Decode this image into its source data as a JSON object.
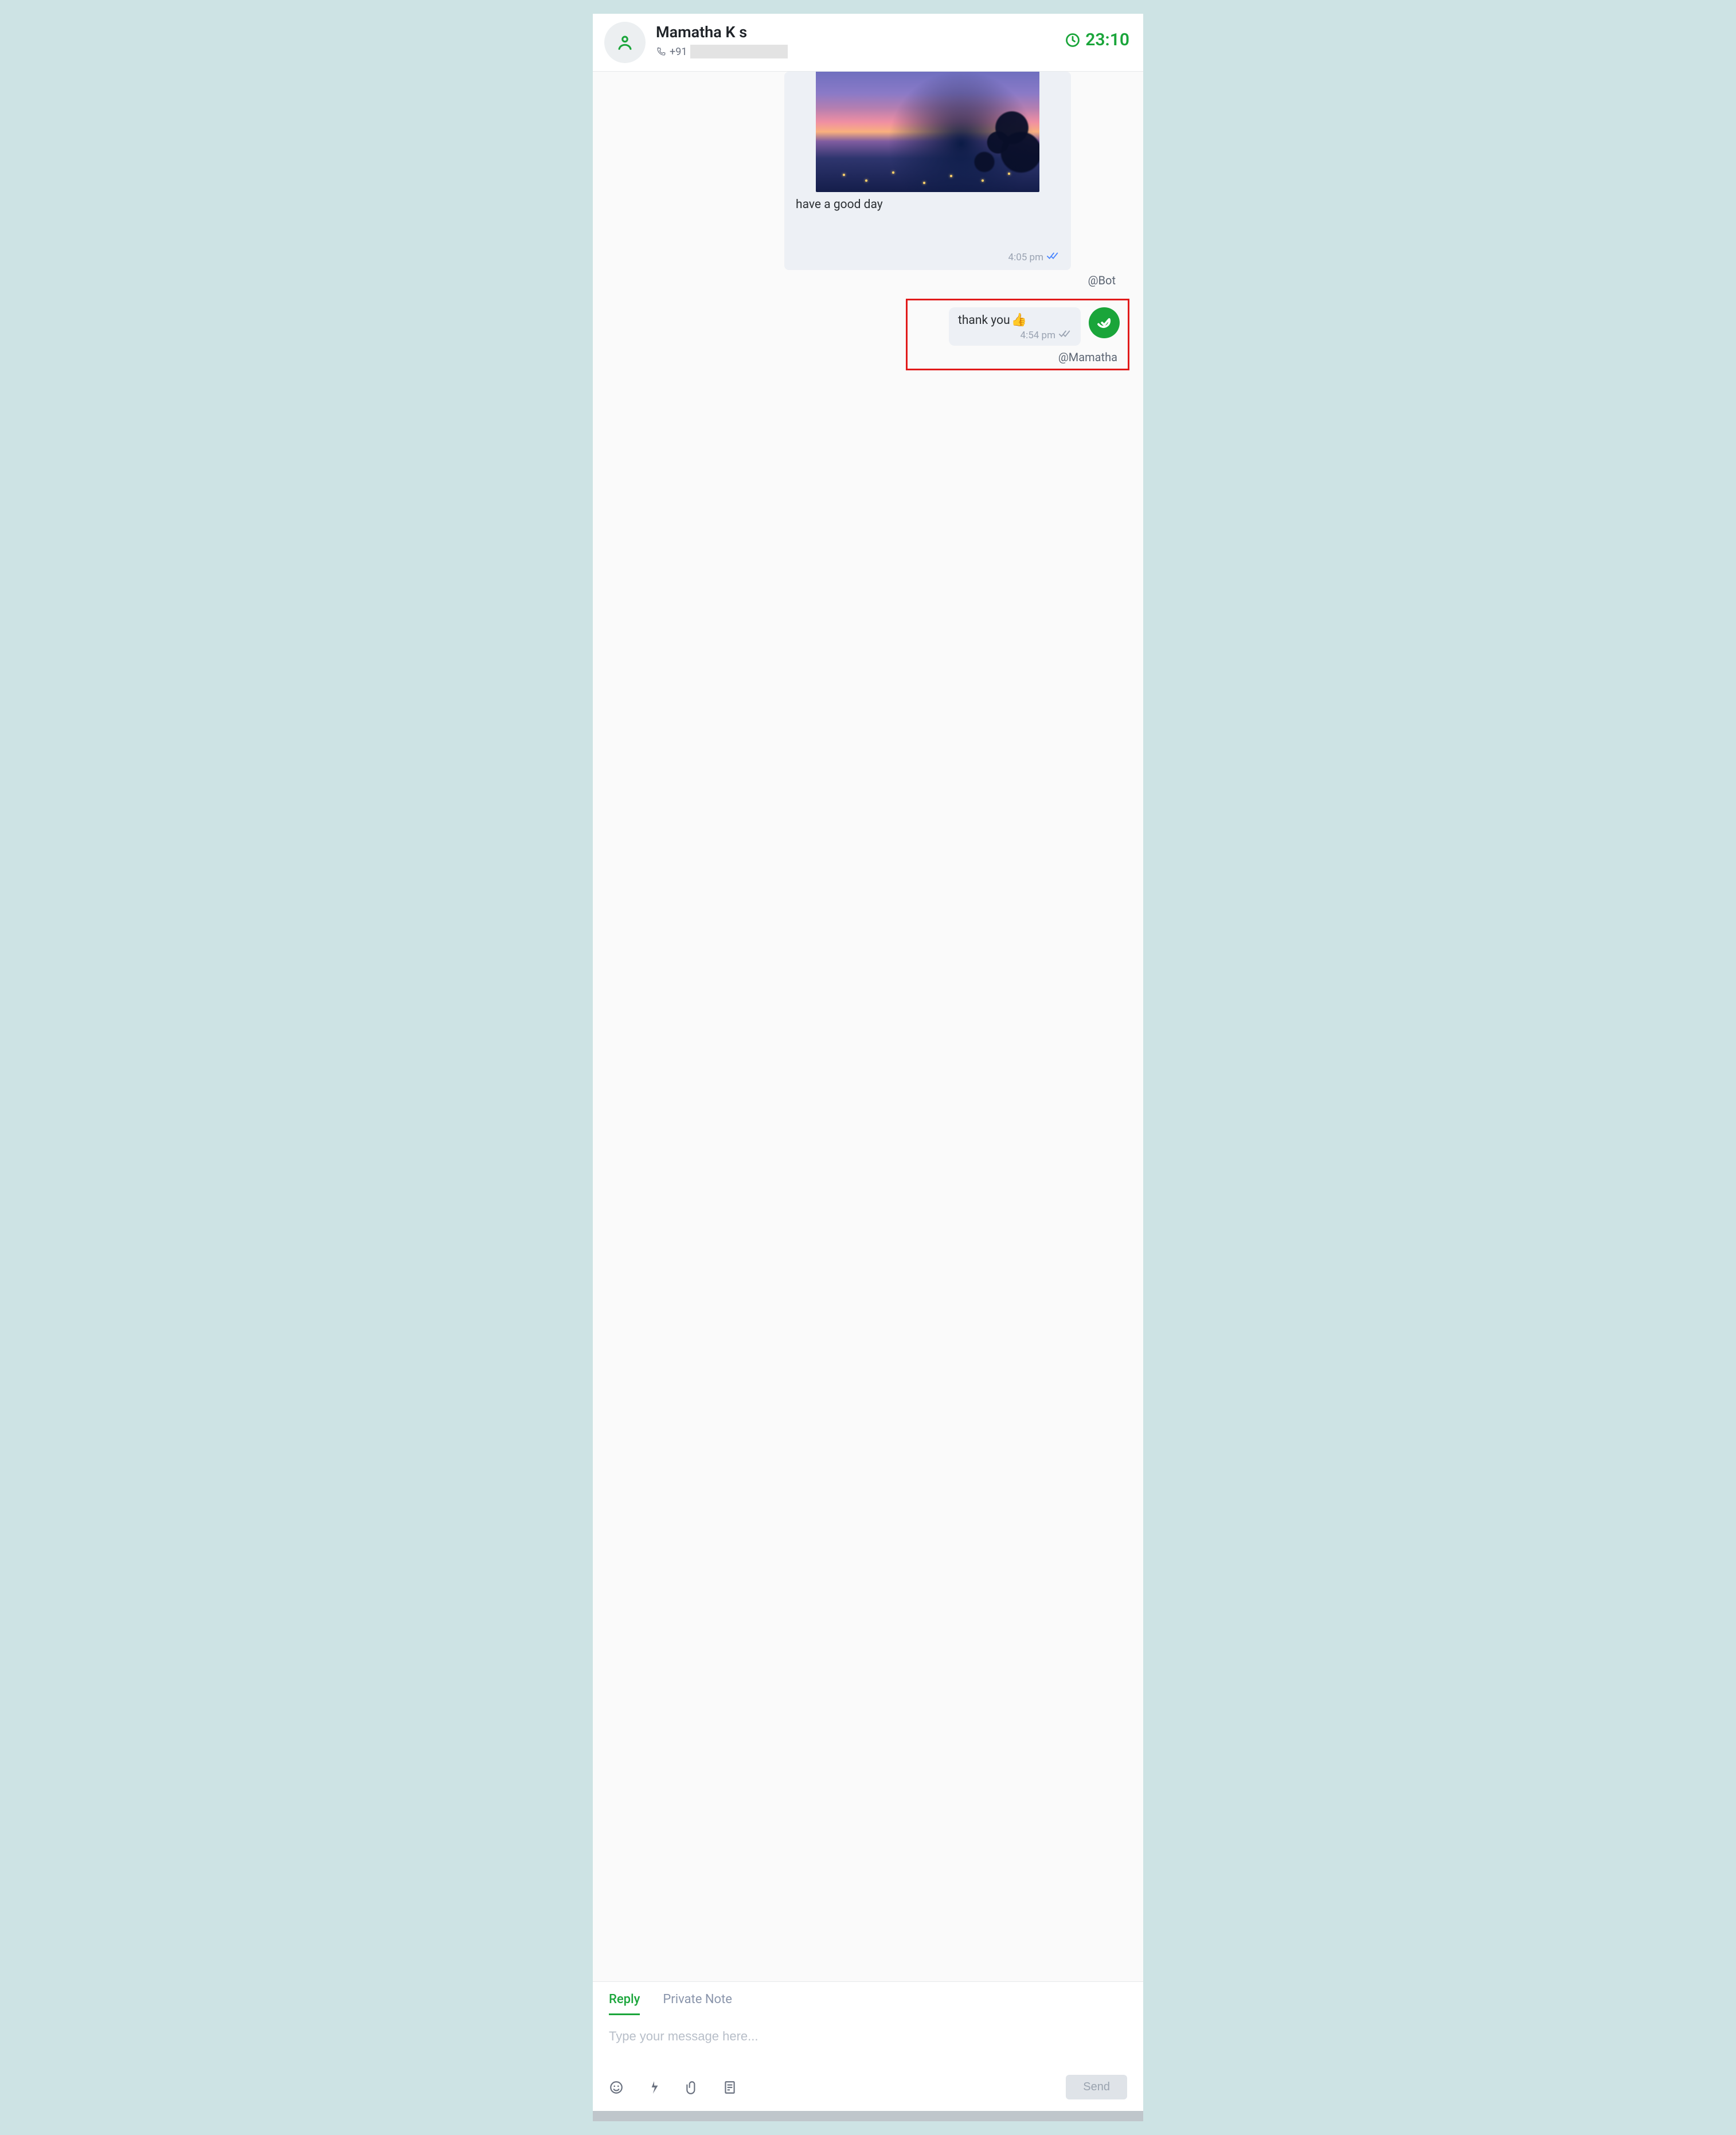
{
  "header": {
    "contact_name": "Mamatha K s",
    "phone_prefix": "+91",
    "timer": "23:10"
  },
  "messages": {
    "bot": {
      "caption": "have a good day",
      "time": "4:05 pm",
      "sender_tag": "@Bot"
    },
    "agent": {
      "text": "thank you",
      "emoji": "👍",
      "time": "4:54 pm",
      "sender_tag": "@Mamatha"
    }
  },
  "composer": {
    "tab_reply": "Reply",
    "tab_private": "Private Note",
    "placeholder": "Type your message here...",
    "send_label": "Send"
  }
}
